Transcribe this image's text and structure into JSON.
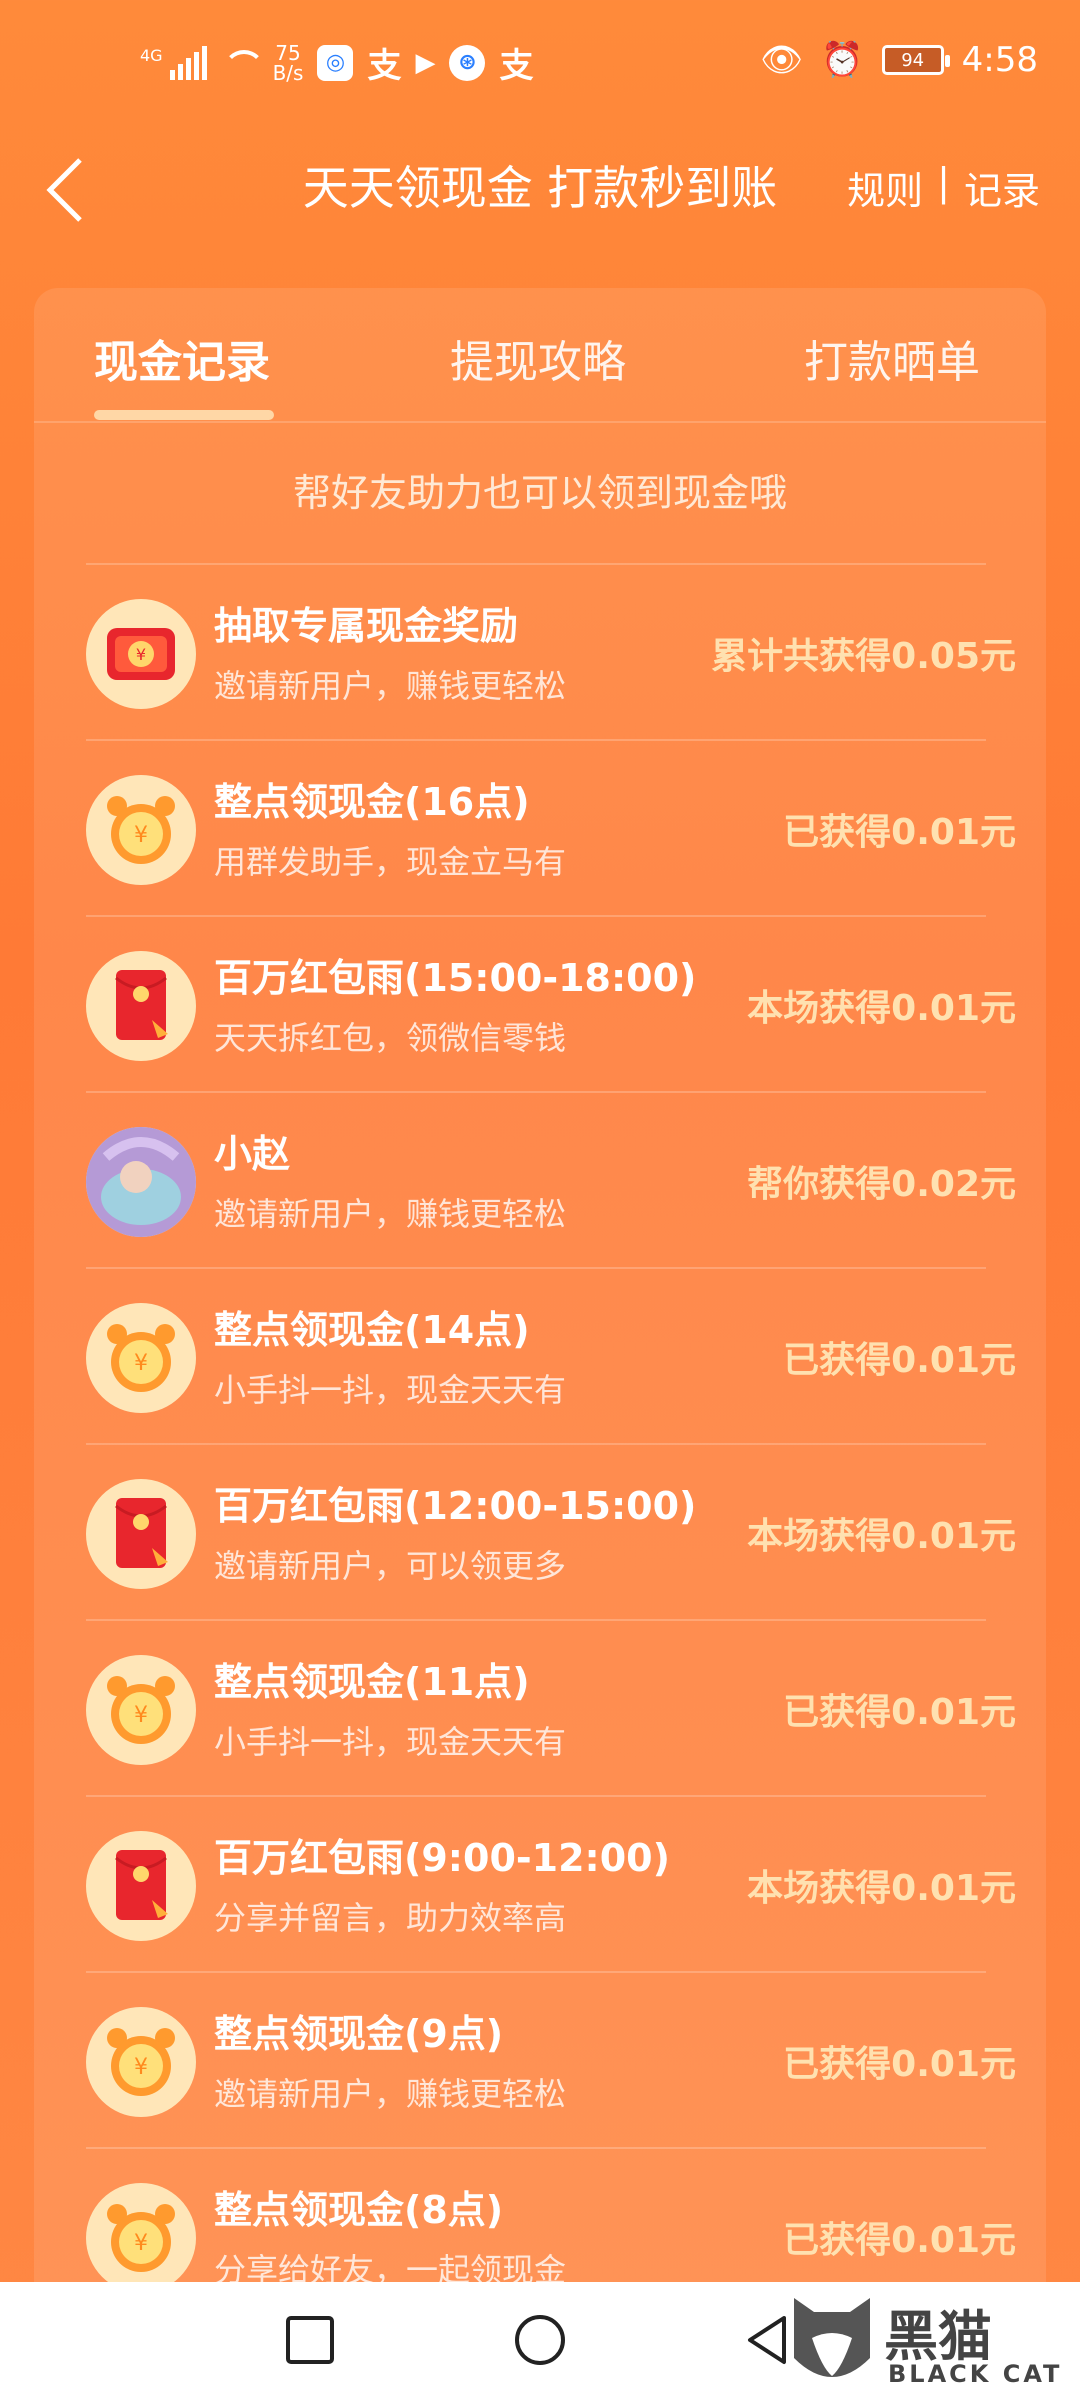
{
  "status_bar": {
    "network": "4G",
    "speed_value": "75",
    "speed_unit": "B/s",
    "battery": "94",
    "time": "4:58"
  },
  "header": {
    "title": "天天领现金 打款秒到账",
    "rules": "规则",
    "separator": "|",
    "records": "记录"
  },
  "tabs": [
    {
      "label": "现金记录",
      "active": true
    },
    {
      "label": "提现攻略",
      "active": false
    },
    {
      "label": "打款晒单",
      "active": false
    }
  ],
  "hint": "帮好友助力也可以领到现金哦",
  "records": [
    {
      "icon": "cash-envelope-icon",
      "title": "抽取专属现金奖励",
      "subtitle": "邀请新用户，赚钱更轻松",
      "amount": "累计共获得0.05元"
    },
    {
      "icon": "alarm-clock-icon",
      "title": "整点领现金(16点)",
      "subtitle": "用群发助手，现金立马有",
      "amount": "已获得0.01元"
    },
    {
      "icon": "red-packet-icon",
      "title": "百万红包雨(15:00-18:00)",
      "subtitle": "天天拆红包，领微信零钱",
      "amount": "本场获得0.01元"
    },
    {
      "icon": "avatar",
      "title": "小赵",
      "subtitle": "邀请新用户，赚钱更轻松",
      "amount": "帮你获得0.02元"
    },
    {
      "icon": "alarm-clock-icon",
      "title": "整点领现金(14点)",
      "subtitle": "小手抖一抖，现金天天有",
      "amount": "已获得0.01元"
    },
    {
      "icon": "red-packet-icon",
      "title": "百万红包雨(12:00-15:00)",
      "subtitle": "邀请新用户，可以领更多",
      "amount": "本场获得0.01元"
    },
    {
      "icon": "alarm-clock-icon",
      "title": "整点领现金(11点)",
      "subtitle": "小手抖一抖，现金天天有",
      "amount": "已获得0.01元"
    },
    {
      "icon": "red-packet-icon",
      "title": "百万红包雨(9:00-12:00)",
      "subtitle": "分享并留言，助力效率高",
      "amount": "本场获得0.01元"
    },
    {
      "icon": "alarm-clock-icon",
      "title": "整点领现金(9点)",
      "subtitle": "邀请新用户，赚钱更轻松",
      "amount": "已获得0.01元"
    },
    {
      "icon": "alarm-clock-icon",
      "title": "整点领现金(8点)",
      "subtitle": "分享给好友，一起领现金",
      "amount": "已获得0.01元"
    }
  ],
  "watermark": {
    "text": "黑猫",
    "sub": "BLACK CAT"
  },
  "colors": {
    "accent": "#ff7a36",
    "amount": "#ffe1b0",
    "icon_bg": "#ffe6b8",
    "red": "#e8262d"
  }
}
